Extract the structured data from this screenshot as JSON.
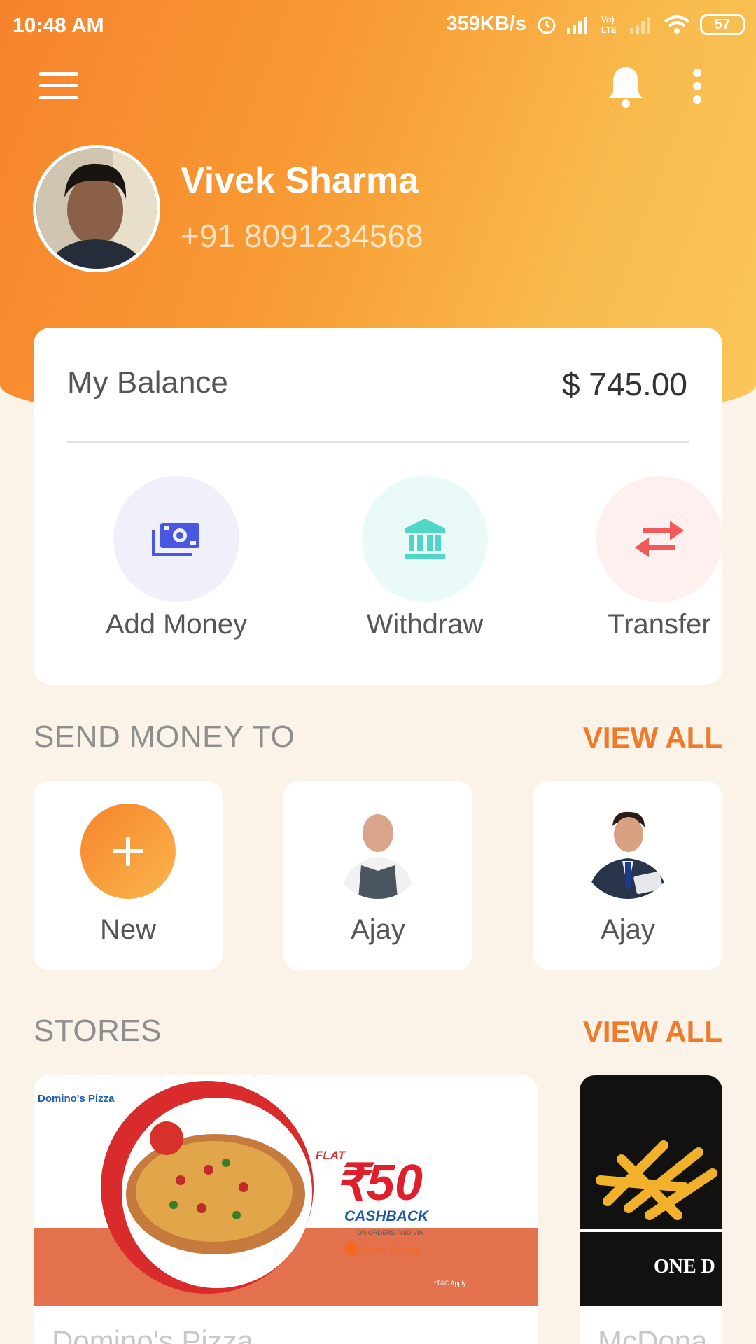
{
  "status_bar": {
    "time": "10:48 AM",
    "speed": "359KB/s",
    "battery": "57"
  },
  "profile": {
    "name": "Vivek Sharma",
    "phone": "+91 8091234568"
  },
  "balance": {
    "label": "My Balance",
    "value": "$ 745.00"
  },
  "actions": [
    {
      "label": "Add Money",
      "icon": "money-icon",
      "color": "#4a57e0"
    },
    {
      "label": "Withdraw",
      "icon": "bank-icon",
      "color": "#4fd6c5"
    },
    {
      "label": "Transfer",
      "icon": "transfer-arrows-icon",
      "color": "#f15a5a"
    }
  ],
  "send_money": {
    "title": "SEND MONEY TO",
    "view_all": "VIEW ALL",
    "contacts": [
      {
        "name": "New"
      },
      {
        "name": "Ajay"
      },
      {
        "name": "Ajay"
      }
    ]
  },
  "stores": {
    "title": "STORES",
    "view_all": "VIEW ALL",
    "items": [
      {
        "name": "Domino's Pizza",
        "brand_logo": "Domino's Pizza",
        "flat": "FLAT",
        "amount": "₹50",
        "cashback": "CASHBACK",
        "subtext": "ON ORDERS PAID VIA",
        "partner": "freecharge",
        "tnc": "*T&C Apply"
      },
      {
        "name": "McDona",
        "banner": "ONE D"
      }
    ]
  },
  "colors": {
    "accent": "#f07a2c",
    "header_start": "#f7832c",
    "header_end": "#fac65a",
    "page_bg": "#fbf2e8"
  }
}
